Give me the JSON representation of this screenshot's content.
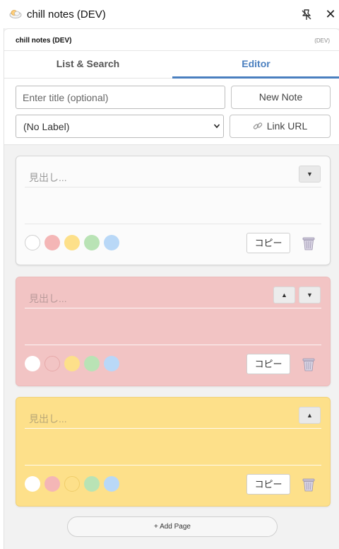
{
  "window": {
    "title": "chill notes (DEV)",
    "pin_icon": "pin-off-icon",
    "close_icon": "close-icon",
    "close_glyph": "✕"
  },
  "subheader": {
    "name": "chill notes (DEV)",
    "env": "(DEV)"
  },
  "tabs": [
    {
      "label": "List & Search",
      "active": false
    },
    {
      "label": "Editor",
      "active": true
    }
  ],
  "form": {
    "title_placeholder": "Enter title (optional)",
    "title_value": "",
    "new_note_label": "New Note",
    "label_select_value": "(No Label)",
    "link_url_label": "Link URL",
    "link_icon": "link-icon"
  },
  "notes": [
    {
      "color": "#fbfbfb",
      "heading_placeholder": "見出し...",
      "arrows": [
        "▼"
      ],
      "copy_label": "コピー",
      "selected_swatch": "white"
    },
    {
      "color": "#f2c4c4",
      "heading_placeholder": "見出し...",
      "arrows": [
        "▲",
        "▼"
      ],
      "copy_label": "コピー",
      "selected_swatch": "pink"
    },
    {
      "color": "#fde08a",
      "heading_placeholder": "見出し...",
      "arrows": [
        "▲"
      ],
      "copy_label": "コピー",
      "selected_swatch": "yellow"
    }
  ],
  "swatch_colors": {
    "white": "#ffffff",
    "pink": "#f4b6b6",
    "yellow": "#fde08a",
    "green": "#b9e3b5",
    "blue": "#b9d8f7"
  },
  "add_page_label": "+ Add Page",
  "accent_color": "#4a7fbf"
}
